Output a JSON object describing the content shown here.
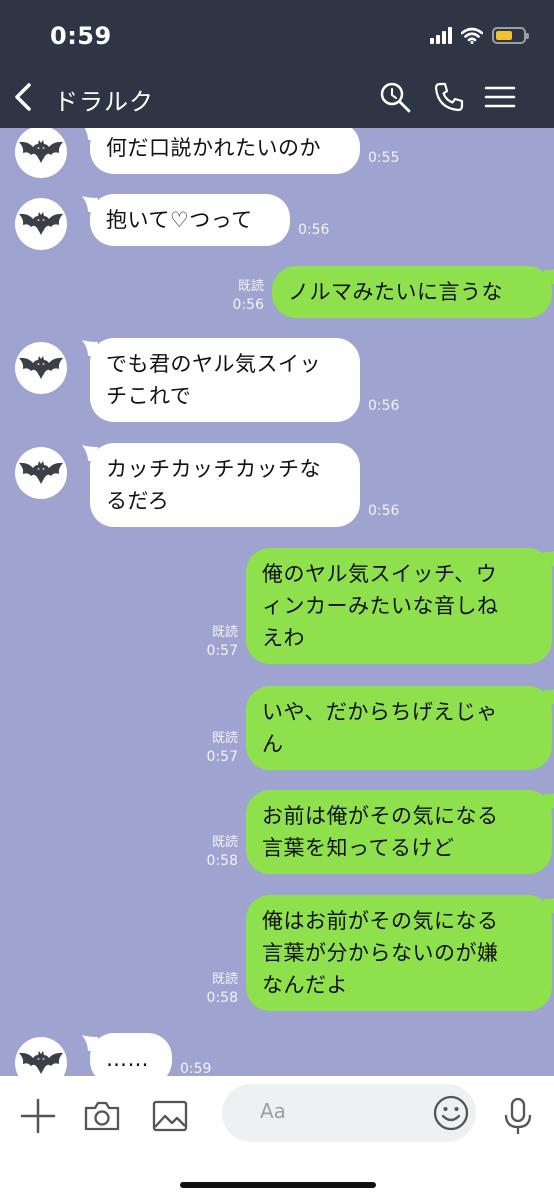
{
  "status": {
    "time": "0:59",
    "battery_color": "#f2c230"
  },
  "header": {
    "title": "ドラルク",
    "icons": [
      "back-chevron-icon",
      "search-icon",
      "phone-icon",
      "menu-icon"
    ]
  },
  "colors": {
    "chat_bg": "#9fa3cf",
    "incoming_bubble": "#ffffff",
    "outgoing_bubble": "#8ee04c",
    "header_bg": "#2e3646"
  },
  "messages": [
    {
      "dir": "in",
      "lines": [
        "何だ口説かれたいのか"
      ],
      "time": "0:55"
    },
    {
      "dir": "in",
      "lines": [
        "抱いて♡つって"
      ],
      "time": "0:56"
    },
    {
      "dir": "out",
      "lines": [
        "ノルマみたいに言うな"
      ],
      "read": "既読",
      "time": "0:56"
    },
    {
      "dir": "in",
      "lines": [
        "でも君のヤル気スイッ",
        "チこれで"
      ],
      "time": "0:56"
    },
    {
      "dir": "in",
      "lines": [
        "カッチカッチカッチな",
        "るだろ"
      ],
      "time": "0:56"
    },
    {
      "dir": "out",
      "lines": [
        "俺のヤル気スイッチ、ウ",
        "ィンカーみたいな音しね",
        "えわ"
      ],
      "read": "既読",
      "time": "0:57"
    },
    {
      "dir": "out",
      "lines": [
        "いや、だからちげえじゃ",
        "ん"
      ],
      "read": "既読",
      "time": "0:57"
    },
    {
      "dir": "out",
      "lines": [
        "お前は俺がその気になる",
        "言葉を知ってるけど"
      ],
      "read": "既読",
      "time": "0:58"
    },
    {
      "dir": "out",
      "lines": [
        "俺はお前がその気になる",
        "言葉が分からないのが嫌",
        "なんだよ"
      ],
      "read": "既読",
      "time": "0:58"
    },
    {
      "dir": "in",
      "lines": [
        "……"
      ],
      "time": "0:59"
    }
  ],
  "input": {
    "placeholder": "Aa",
    "icons": [
      "plus-icon",
      "camera-icon",
      "image-icon",
      "smiley-icon",
      "microphone-icon"
    ]
  }
}
